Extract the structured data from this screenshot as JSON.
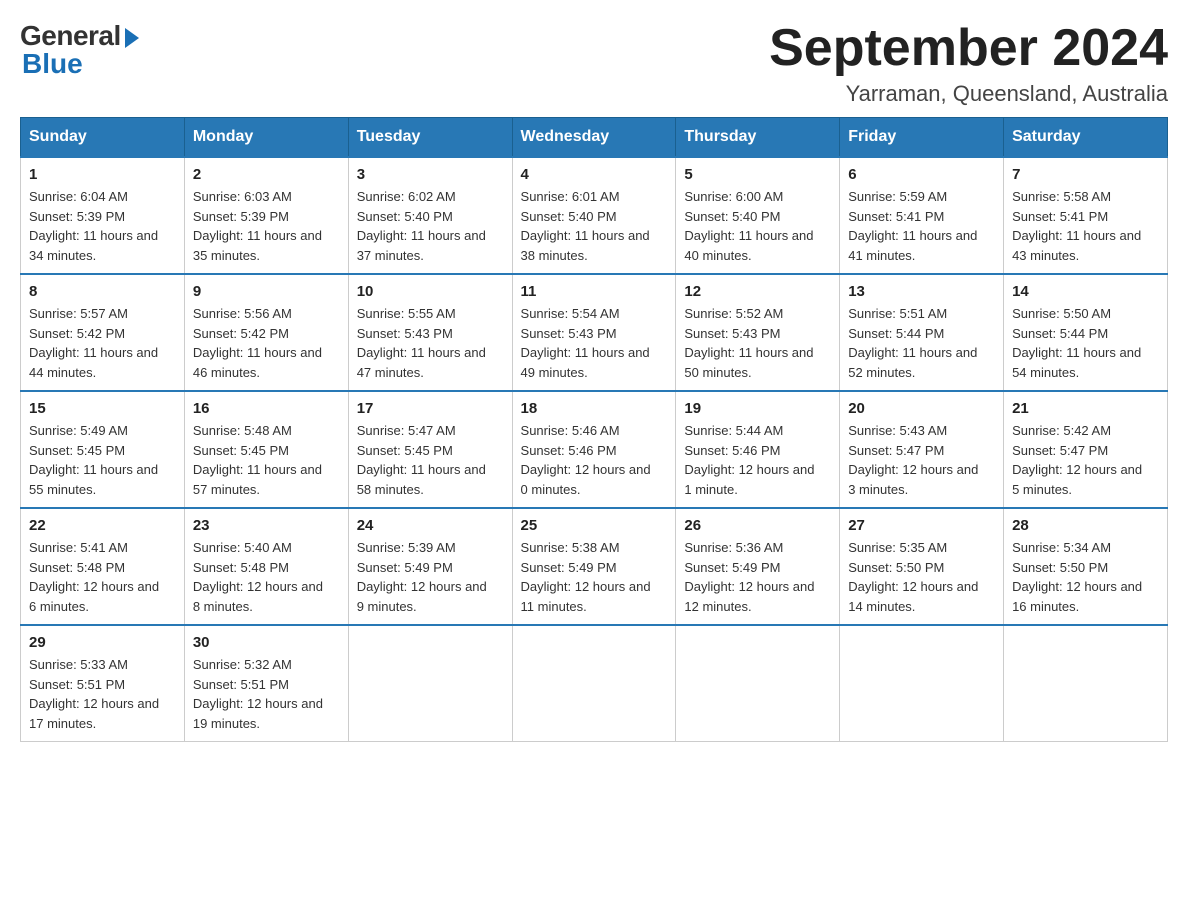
{
  "logo": {
    "general": "General",
    "blue": "Blue"
  },
  "title": {
    "month_year": "September 2024",
    "location": "Yarraman, Queensland, Australia"
  },
  "weekdays": [
    "Sunday",
    "Monday",
    "Tuesday",
    "Wednesday",
    "Thursday",
    "Friday",
    "Saturday"
  ],
  "weeks": [
    [
      {
        "day": "1",
        "sunrise": "6:04 AM",
        "sunset": "5:39 PM",
        "daylight": "11 hours and 34 minutes."
      },
      {
        "day": "2",
        "sunrise": "6:03 AM",
        "sunset": "5:39 PM",
        "daylight": "11 hours and 35 minutes."
      },
      {
        "day": "3",
        "sunrise": "6:02 AM",
        "sunset": "5:40 PM",
        "daylight": "11 hours and 37 minutes."
      },
      {
        "day": "4",
        "sunrise": "6:01 AM",
        "sunset": "5:40 PM",
        "daylight": "11 hours and 38 minutes."
      },
      {
        "day": "5",
        "sunrise": "6:00 AM",
        "sunset": "5:40 PM",
        "daylight": "11 hours and 40 minutes."
      },
      {
        "day": "6",
        "sunrise": "5:59 AM",
        "sunset": "5:41 PM",
        "daylight": "11 hours and 41 minutes."
      },
      {
        "day": "7",
        "sunrise": "5:58 AM",
        "sunset": "5:41 PM",
        "daylight": "11 hours and 43 minutes."
      }
    ],
    [
      {
        "day": "8",
        "sunrise": "5:57 AM",
        "sunset": "5:42 PM",
        "daylight": "11 hours and 44 minutes."
      },
      {
        "day": "9",
        "sunrise": "5:56 AM",
        "sunset": "5:42 PM",
        "daylight": "11 hours and 46 minutes."
      },
      {
        "day": "10",
        "sunrise": "5:55 AM",
        "sunset": "5:43 PM",
        "daylight": "11 hours and 47 minutes."
      },
      {
        "day": "11",
        "sunrise": "5:54 AM",
        "sunset": "5:43 PM",
        "daylight": "11 hours and 49 minutes."
      },
      {
        "day": "12",
        "sunrise": "5:52 AM",
        "sunset": "5:43 PM",
        "daylight": "11 hours and 50 minutes."
      },
      {
        "day": "13",
        "sunrise": "5:51 AM",
        "sunset": "5:44 PM",
        "daylight": "11 hours and 52 minutes."
      },
      {
        "day": "14",
        "sunrise": "5:50 AM",
        "sunset": "5:44 PM",
        "daylight": "11 hours and 54 minutes."
      }
    ],
    [
      {
        "day": "15",
        "sunrise": "5:49 AM",
        "sunset": "5:45 PM",
        "daylight": "11 hours and 55 minutes."
      },
      {
        "day": "16",
        "sunrise": "5:48 AM",
        "sunset": "5:45 PM",
        "daylight": "11 hours and 57 minutes."
      },
      {
        "day": "17",
        "sunrise": "5:47 AM",
        "sunset": "5:45 PM",
        "daylight": "11 hours and 58 minutes."
      },
      {
        "day": "18",
        "sunrise": "5:46 AM",
        "sunset": "5:46 PM",
        "daylight": "12 hours and 0 minutes."
      },
      {
        "day": "19",
        "sunrise": "5:44 AM",
        "sunset": "5:46 PM",
        "daylight": "12 hours and 1 minute."
      },
      {
        "day": "20",
        "sunrise": "5:43 AM",
        "sunset": "5:47 PM",
        "daylight": "12 hours and 3 minutes."
      },
      {
        "day": "21",
        "sunrise": "5:42 AM",
        "sunset": "5:47 PM",
        "daylight": "12 hours and 5 minutes."
      }
    ],
    [
      {
        "day": "22",
        "sunrise": "5:41 AM",
        "sunset": "5:48 PM",
        "daylight": "12 hours and 6 minutes."
      },
      {
        "day": "23",
        "sunrise": "5:40 AM",
        "sunset": "5:48 PM",
        "daylight": "12 hours and 8 minutes."
      },
      {
        "day": "24",
        "sunrise": "5:39 AM",
        "sunset": "5:49 PM",
        "daylight": "12 hours and 9 minutes."
      },
      {
        "day": "25",
        "sunrise": "5:38 AM",
        "sunset": "5:49 PM",
        "daylight": "12 hours and 11 minutes."
      },
      {
        "day": "26",
        "sunrise": "5:36 AM",
        "sunset": "5:49 PM",
        "daylight": "12 hours and 12 minutes."
      },
      {
        "day": "27",
        "sunrise": "5:35 AM",
        "sunset": "5:50 PM",
        "daylight": "12 hours and 14 minutes."
      },
      {
        "day": "28",
        "sunrise": "5:34 AM",
        "sunset": "5:50 PM",
        "daylight": "12 hours and 16 minutes."
      }
    ],
    [
      {
        "day": "29",
        "sunrise": "5:33 AM",
        "sunset": "5:51 PM",
        "daylight": "12 hours and 17 minutes."
      },
      {
        "day": "30",
        "sunrise": "5:32 AM",
        "sunset": "5:51 PM",
        "daylight": "12 hours and 19 minutes."
      },
      null,
      null,
      null,
      null,
      null
    ]
  ]
}
